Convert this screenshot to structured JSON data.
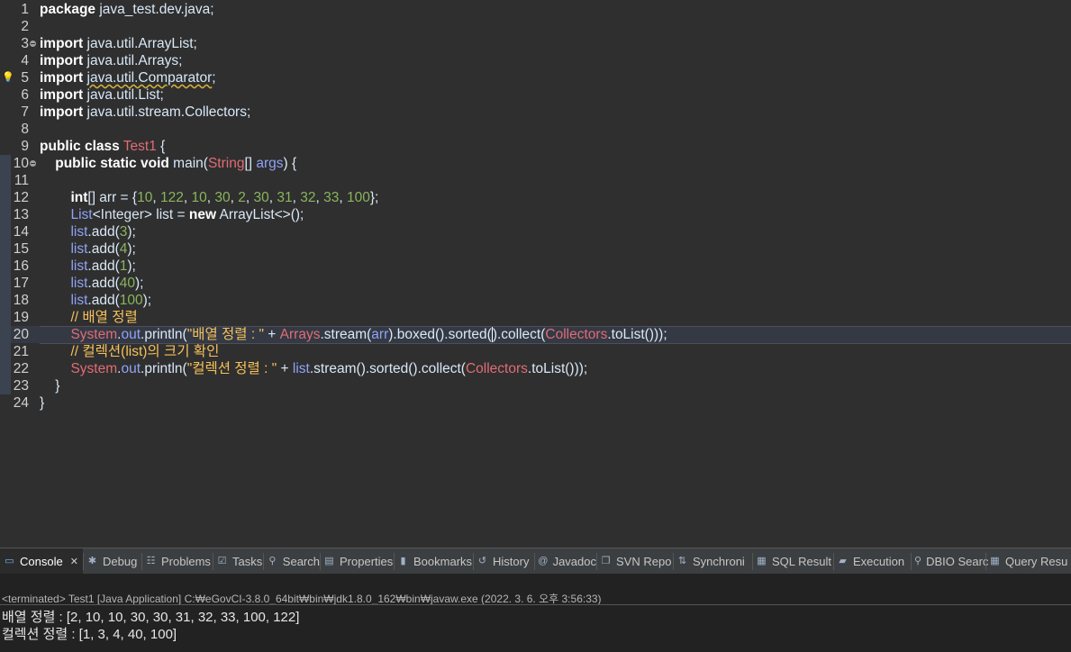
{
  "editor": {
    "lines": [
      {
        "n": "1",
        "parts": [
          [
            "kw",
            "package"
          ],
          [
            "t",
            " java_test.dev.java;"
          ]
        ]
      },
      {
        "n": "2",
        "parts": []
      },
      {
        "n": "3",
        "parts": [
          [
            "kw",
            "import"
          ],
          [
            "t",
            " java.util.ArrayList;"
          ]
        ]
      },
      {
        "n": "4",
        "parts": [
          [
            "kw",
            "import"
          ],
          [
            "t",
            " java.util.Arrays;"
          ]
        ]
      },
      {
        "n": "5",
        "parts": [
          [
            "kw",
            "import"
          ],
          [
            "t",
            " "
          ],
          [
            "sq",
            "java.util.Comparator"
          ],
          [
            "t",
            ";"
          ]
        ]
      },
      {
        "n": "6",
        "parts": [
          [
            "kw",
            "import"
          ],
          [
            "t",
            " java.util.List;"
          ]
        ]
      },
      {
        "n": "7",
        "parts": [
          [
            "kw",
            "import"
          ],
          [
            "t",
            " java.util.stream.Collectors;"
          ]
        ]
      },
      {
        "n": "8",
        "parts": []
      },
      {
        "n": "9",
        "parts": [
          [
            "kw",
            "public"
          ],
          [
            "t",
            " "
          ],
          [
            "kw",
            "class"
          ],
          [
            "t",
            " "
          ],
          [
            "cls",
            "Test1"
          ],
          [
            "t",
            " {"
          ]
        ]
      },
      {
        "n": "10",
        "parts": [
          [
            "t",
            "    "
          ],
          [
            "kw",
            "public"
          ],
          [
            "t",
            " "
          ],
          [
            "kw",
            "static"
          ],
          [
            "t",
            " "
          ],
          [
            "kw",
            "void"
          ],
          [
            "t",
            " main("
          ],
          [
            "cls",
            "String"
          ],
          [
            "t",
            "[] "
          ],
          [
            "fld",
            "args"
          ],
          [
            "t",
            ") {"
          ]
        ]
      },
      {
        "n": "11",
        "parts": []
      },
      {
        "n": "12",
        "parts": [
          [
            "t",
            "        "
          ],
          [
            "kw",
            "int"
          ],
          [
            "t",
            "[] arr = {"
          ],
          [
            "num",
            "10"
          ],
          [
            "t",
            ", "
          ],
          [
            "num",
            "122"
          ],
          [
            "t",
            ", "
          ],
          [
            "num",
            "10"
          ],
          [
            "t",
            ", "
          ],
          [
            "num",
            "30"
          ],
          [
            "t",
            ", "
          ],
          [
            "num",
            "2"
          ],
          [
            "t",
            ", "
          ],
          [
            "num",
            "30"
          ],
          [
            "t",
            ", "
          ],
          [
            "num",
            "31"
          ],
          [
            "t",
            ", "
          ],
          [
            "num",
            "32"
          ],
          [
            "t",
            ", "
          ],
          [
            "num",
            "33"
          ],
          [
            "t",
            ", "
          ],
          [
            "num",
            "100"
          ],
          [
            "t",
            "};"
          ]
        ]
      },
      {
        "n": "13",
        "parts": [
          [
            "t",
            "        "
          ],
          [
            "fld",
            "List"
          ],
          [
            "t",
            "<"
          ],
          [
            "typ",
            "Integer"
          ],
          [
            "t",
            "> list = "
          ],
          [
            "kw",
            "new"
          ],
          [
            "t",
            " ArrayList<>();"
          ]
        ]
      },
      {
        "n": "14",
        "parts": [
          [
            "t",
            "        "
          ],
          [
            "fld",
            "list"
          ],
          [
            "t",
            ".add("
          ],
          [
            "num",
            "3"
          ],
          [
            "t",
            ");"
          ]
        ]
      },
      {
        "n": "15",
        "parts": [
          [
            "t",
            "        "
          ],
          [
            "fld",
            "list"
          ],
          [
            "t",
            ".add("
          ],
          [
            "num",
            "4"
          ],
          [
            "t",
            ");"
          ]
        ]
      },
      {
        "n": "16",
        "parts": [
          [
            "t",
            "        "
          ],
          [
            "fld",
            "list"
          ],
          [
            "t",
            ".add("
          ],
          [
            "num",
            "1"
          ],
          [
            "t",
            ");"
          ]
        ]
      },
      {
        "n": "17",
        "parts": [
          [
            "t",
            "        "
          ],
          [
            "fld",
            "list"
          ],
          [
            "t",
            ".add("
          ],
          [
            "num",
            "40"
          ],
          [
            "t",
            ");"
          ]
        ]
      },
      {
        "n": "18",
        "parts": [
          [
            "t",
            "        "
          ],
          [
            "fld",
            "list"
          ],
          [
            "t",
            ".add("
          ],
          [
            "num",
            "100"
          ],
          [
            "t",
            ");"
          ]
        ]
      },
      {
        "n": "19",
        "parts": [
          [
            "t",
            "        "
          ],
          [
            "cmt",
            "// 배열 정렬"
          ]
        ]
      },
      {
        "n": "20",
        "parts": [
          [
            "t",
            "        "
          ],
          [
            "cls",
            "System"
          ],
          [
            "t",
            "."
          ],
          [
            "fld",
            "out"
          ],
          [
            "t",
            ".println("
          ],
          [
            "str",
            "\"배열 정렬 : \""
          ],
          [
            "t",
            " + "
          ],
          [
            "cls",
            "Arrays"
          ],
          [
            "t",
            ".stream("
          ],
          [
            "fld",
            "arr"
          ],
          [
            "t",
            ").boxed().sorted("
          ],
          [
            "cur",
            ""
          ],
          [
            "t",
            ").collect("
          ],
          [
            "cls",
            "Collectors"
          ],
          [
            "t",
            ".toList()));"
          ]
        ]
      },
      {
        "n": "21",
        "parts": [
          [
            "t",
            "        "
          ],
          [
            "cmt",
            "// 컬렉션(list)의 크기 확인"
          ]
        ]
      },
      {
        "n": "22",
        "parts": [
          [
            "t",
            "        "
          ],
          [
            "cls",
            "System"
          ],
          [
            "t",
            "."
          ],
          [
            "fld",
            "out"
          ],
          [
            "t",
            ".println("
          ],
          [
            "str",
            "\"컬렉션 정렬 : \""
          ],
          [
            "t",
            " + "
          ],
          [
            "fld",
            "list"
          ],
          [
            "t",
            ".stream().sorted().collect("
          ],
          [
            "cls",
            "Collectors"
          ],
          [
            "t",
            ".toList()));"
          ]
        ]
      },
      {
        "n": "23",
        "parts": [
          [
            "t",
            "    }"
          ]
        ]
      },
      {
        "n": "24",
        "parts": [
          [
            "t",
            "}"
          ]
        ]
      }
    ]
  },
  "tabs": [
    {
      "label": "Console",
      "icon": "console-icon",
      "glyph": "▭",
      "active": true,
      "close": "✕"
    },
    {
      "label": "Debug",
      "icon": "debug-icon",
      "glyph": "✱"
    },
    {
      "label": "Problems",
      "icon": "problems-icon",
      "glyph": "☷"
    },
    {
      "label": "Tasks",
      "icon": "tasks-icon",
      "glyph": "☑"
    },
    {
      "label": "Search",
      "icon": "search-icon",
      "glyph": "⚲"
    },
    {
      "label": "Properties",
      "icon": "properties-icon",
      "glyph": "▤"
    },
    {
      "label": "Bookmarks",
      "icon": "bookmark-icon",
      "glyph": "▮"
    },
    {
      "label": "History",
      "icon": "history-icon",
      "glyph": "↺"
    },
    {
      "label": "Javadoc",
      "icon": "javadoc-icon",
      "glyph": "@"
    },
    {
      "label": "SVN Repo",
      "icon": "svn-icon",
      "glyph": "❐"
    },
    {
      "label": "Synchroni",
      "icon": "synchronize-icon",
      "glyph": "⇅"
    },
    {
      "label": "SQL Result",
      "icon": "sql-result-icon",
      "glyph": "▦"
    },
    {
      "label": "Execution",
      "icon": "execution-icon",
      "glyph": "▰"
    },
    {
      "label": "DBIO Searc",
      "icon": "dbio-search-icon",
      "glyph": "⚲"
    },
    {
      "label": "Query Resu",
      "icon": "query-result-icon",
      "glyph": "▦"
    }
  ],
  "console": {
    "status": "<terminated> Test1 [Java Application] C:₩eGovCI-3.8.0_64bit₩bin₩jdk1.8.0_162₩bin₩javaw.exe (2022. 3. 6. 오후 3:56:33)",
    "output": [
      "배열 정렬 : [2, 10, 10, 30, 30, 31, 32, 33, 100, 122]",
      "컬렉션 정렬 : [1, 3, 4, 40, 100]"
    ]
  },
  "colors": {
    "keyword": "#cc7832",
    "class": "#e06c75",
    "number": "#8ab55d",
    "string": "#f7c15a",
    "field": "#8fa3f5"
  }
}
